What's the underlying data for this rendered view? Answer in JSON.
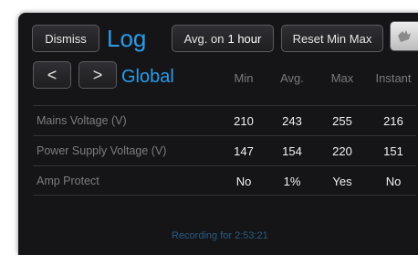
{
  "toolbar": {
    "dismiss_label": "Dismiss",
    "title": "Log",
    "avg_prefix": "Avg. on",
    "avg_value": "1 hour",
    "reset_label": "Reset Min Max"
  },
  "nav": {
    "prev_label": "<",
    "next_label": ">",
    "scope": "Global"
  },
  "table": {
    "columns": [
      "Min",
      "Avg.",
      "Max",
      "Instant"
    ],
    "rows": [
      {
        "label": "Mains Voltage (V)",
        "values": [
          "210",
          "243",
          "255",
          "216"
        ]
      },
      {
        "label": "Power Supply Voltage (V)",
        "values": [
          "147",
          "154",
          "220",
          "151"
        ]
      },
      {
        "label": "Amp Protect",
        "values": [
          "No",
          "1%",
          "Yes",
          "No"
        ]
      }
    ]
  },
  "footer": {
    "status": "Recording for 2:53:21"
  },
  "colors": {
    "accent": "#2b9bea",
    "background": "#151517",
    "text": "#f2f2f2",
    "muted": "#7d7d82"
  },
  "icons": {
    "corner_button": "partially-visible-icon"
  }
}
